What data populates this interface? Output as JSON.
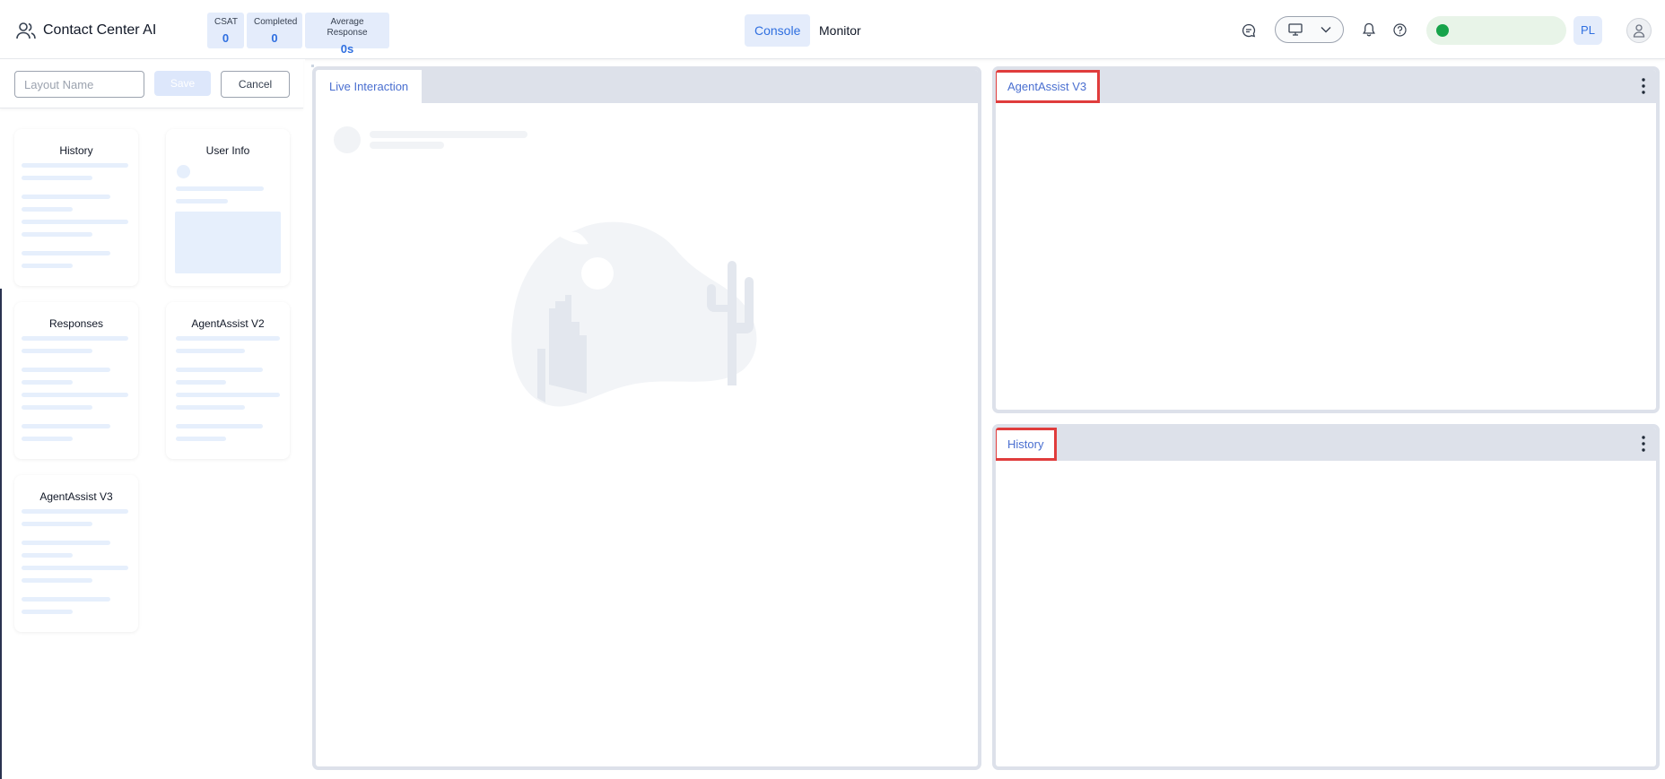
{
  "header": {
    "app_title": "Contact Center AI",
    "metrics": [
      {
        "label": "CSAT",
        "value": "0"
      },
      {
        "label": "Completed",
        "value": "0"
      },
      {
        "label": "Average Response",
        "value": "0s"
      }
    ],
    "tabs": [
      {
        "label": "Console",
        "active": true
      },
      {
        "label": "Monitor",
        "active": false
      }
    ],
    "user_initials": "PL",
    "status_color": "#16a34a"
  },
  "layout_editor": {
    "name_placeholder": "Layout Name",
    "save_label": "Save",
    "cancel_label": "Cancel",
    "widgets": [
      {
        "title": "History"
      },
      {
        "title": "User Info"
      },
      {
        "title": "Responses"
      },
      {
        "title": "AgentAssist V2"
      },
      {
        "title": "AgentAssist V3"
      }
    ]
  },
  "panels": {
    "main": {
      "tab": "Live Interaction"
    },
    "top_right": {
      "tab": "AgentAssist V3"
    },
    "bottom_right": {
      "tab": "History"
    }
  },
  "colors": {
    "accent": "#2f6fe0",
    "highlight": "#e03c3c",
    "panel_border": "#dde1ea"
  }
}
